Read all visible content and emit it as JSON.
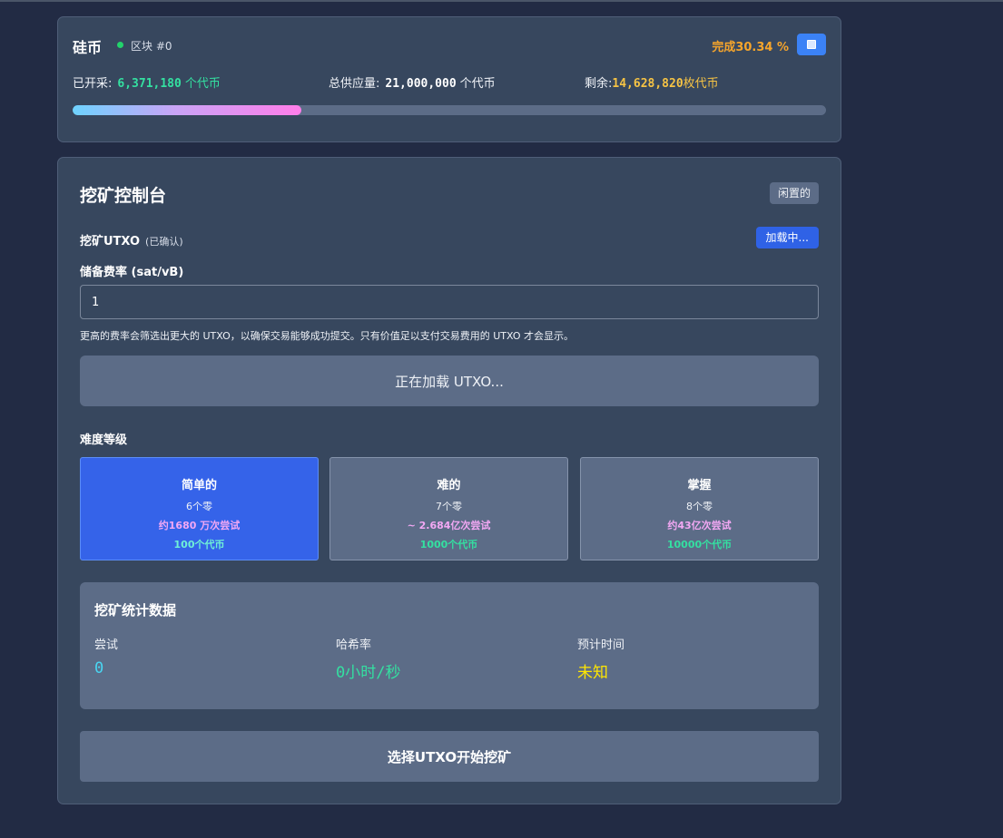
{
  "header": {
    "brand": "硅币",
    "block_label": "区块 #0",
    "progress_text": "完成30.34 %",
    "progress_percent": 30.34,
    "stop_icon": "stop-square-icon"
  },
  "supply": {
    "mined_label": "已开采:",
    "mined_value": "6,371,180",
    "mined_unit": "个代币",
    "total_label": "总供应量:",
    "total_value": "21,000,000",
    "total_unit": "个代币",
    "remaining_label": "剩余:",
    "remaining_value": "14,628,820",
    "remaining_unit": "枚代币"
  },
  "console": {
    "title": "挖矿控制台",
    "status_badge": "闲置的",
    "utxo_label": "挖矿UTXO",
    "utxo_sub": "(已确认)",
    "loading_button": "加载中...",
    "fee_label": "储备费率 (sat/vB)",
    "fee_value": "1",
    "fee_help": "更高的费率会筛选出更大的 UTXO，以确保交易能够成功提交。只有价值足以支付交易费用的 UTXO 才会显示。",
    "utxo_loading": "正在加载 UTXO...",
    "difficulty_label": "难度等级",
    "difficulties": [
      {
        "name": "简单的",
        "zeros": "6个零",
        "tries": "约1680 万次尝试",
        "reward": "100个代币"
      },
      {
        "name": "难的",
        "zeros": "7个零",
        "tries": "~ 2.684亿次尝试",
        "reward": "1000个代币"
      },
      {
        "name": "掌握",
        "zeros": "8个零",
        "tries": "约43亿次尝试",
        "reward": "10000个代币"
      }
    ],
    "stats": {
      "title": "挖矿统计数据",
      "attempts_label": "尝试",
      "attempts_value": "0",
      "hashrate_label": "哈希率",
      "hashrate_value": "0小时/秒",
      "eta_label": "预计时间",
      "eta_value": "未知"
    },
    "start_button": "选择UTXO开始挖矿"
  },
  "colors": {
    "background": "#222b44",
    "card": "#37475e",
    "accent_blue": "#3563e9",
    "orange": "#f6a52b",
    "green": "#34e0a1"
  }
}
